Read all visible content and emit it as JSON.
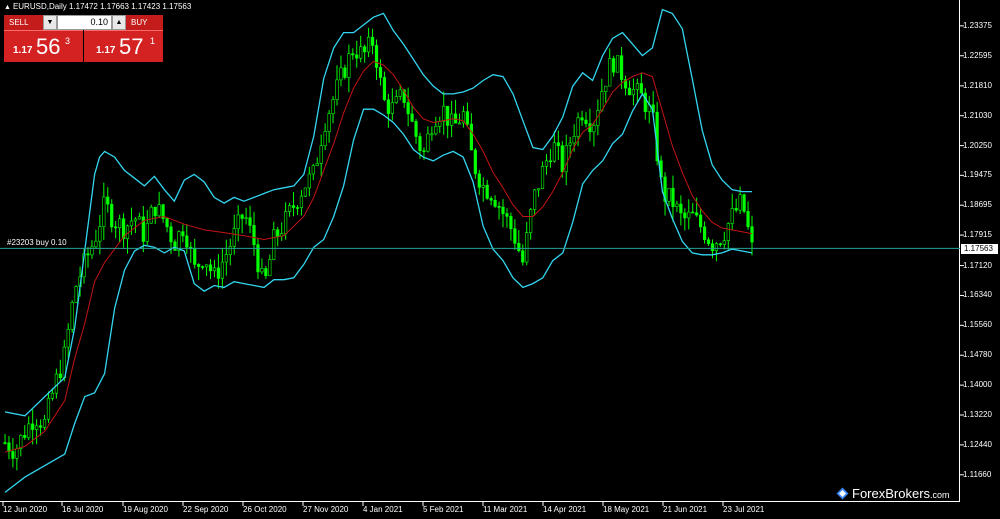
{
  "chart_title": "EURUSD,Daily  1.17472 1.17663 1.17423 1.17563",
  "trade_panel": {
    "sell_label": "SELL",
    "buy_label": "BUY",
    "volume": "0.10",
    "sell_price": {
      "prefix": "1.17",
      "big": "56",
      "sup": "3"
    },
    "buy_price": {
      "prefix": "1.17",
      "big": "57",
      "sup": "1"
    }
  },
  "order_line_label": "#23203 buy 0.10",
  "current_price_tag": "1.17563",
  "watermark": "ForexBrokers",
  "watermark_suffix": ".com",
  "colors": {
    "background": "#000000",
    "candle": "#00ff00",
    "bollinger": "#33d6f0",
    "middle_band": "#c41414",
    "order_line": "#2aa198",
    "sell_button": "#d42222"
  },
  "chart_data": {
    "type": "candlestick",
    "symbol": "EURUSD",
    "timeframe": "Daily",
    "ylim": [
      1.1095,
      1.2405
    ],
    "y_ticks": [
      "1.23375",
      "1.22595",
      "1.21810",
      "1.21030",
      "1.20250",
      "1.19475",
      "1.18695",
      "1.17915",
      "1.17120",
      "1.16340",
      "1.15560",
      "1.14780",
      "1.14000",
      "1.13220",
      "1.12440",
      "1.11660"
    ],
    "x_ticks": [
      "12 Jun 2020",
      "16 Jul 2020",
      "19 Aug 2020",
      "22 Sep 2020",
      "26 Oct 2020",
      "27 Nov 2020",
      "4 Jan 2021",
      "5 Feb 2021",
      "11 Mar 2021",
      "14 Apr 2021",
      "18 May 2021",
      "21 Jun 2021",
      "23 Jul 2021"
    ],
    "current_price": 1.17563,
    "order_price": 1.1758,
    "indicator": "Bollinger Bands",
    "close_path": [
      [
        0,
        1.125
      ],
      [
        10,
        1.123
      ],
      [
        20,
        1.128
      ],
      [
        30,
        1.132
      ],
      [
        40,
        1.13
      ],
      [
        50,
        1.14
      ],
      [
        60,
        1.148
      ],
      [
        70,
        1.165
      ],
      [
        80,
        1.172
      ],
      [
        90,
        1.178
      ],
      [
        100,
        1.187
      ],
      [
        110,
        1.183
      ],
      [
        120,
        1.181
      ],
      [
        130,
        1.184
      ],
      [
        140,
        1.179
      ],
      [
        150,
        1.187
      ],
      [
        160,
        1.183
      ],
      [
        170,
        1.177
      ],
      [
        180,
        1.182
      ],
      [
        190,
        1.17
      ],
      [
        200,
        1.174
      ],
      [
        210,
        1.168
      ],
      [
        220,
        1.173
      ],
      [
        230,
        1.179
      ],
      [
        240,
        1.185
      ],
      [
        250,
        1.177
      ],
      [
        260,
        1.165
      ],
      [
        270,
        1.178
      ],
      [
        280,
        1.182
      ],
      [
        290,
        1.187
      ],
      [
        300,
        1.192
      ],
      [
        310,
        1.195
      ],
      [
        320,
        1.208
      ],
      [
        330,
        1.215
      ],
      [
        340,
        1.222
      ],
      [
        350,
        1.228
      ],
      [
        360,
        1.226
      ],
      [
        370,
        1.23
      ],
      [
        380,
        1.214
      ],
      [
        390,
        1.212
      ],
      [
        400,
        1.216
      ],
      [
        410,
        1.207
      ],
      [
        420,
        1.2
      ],
      [
        430,
        1.21
      ],
      [
        440,
        1.212
      ],
      [
        450,
        1.207
      ],
      [
        460,
        1.211
      ],
      [
        470,
        1.198
      ],
      [
        480,
        1.192
      ],
      [
        490,
        1.19
      ],
      [
        500,
        1.185
      ],
      [
        510,
        1.18
      ],
      [
        520,
        1.172
      ],
      [
        530,
        1.188
      ],
      [
        540,
        1.196
      ],
      [
        550,
        1.203
      ],
      [
        560,
        1.197
      ],
      [
        570,
        1.206
      ],
      [
        580,
        1.212
      ],
      [
        590,
        1.208
      ],
      [
        600,
        1.218
      ],
      [
        610,
        1.225
      ],
      [
        620,
        1.221
      ],
      [
        630,
        1.217
      ],
      [
        640,
        1.215
      ],
      [
        650,
        1.21
      ],
      [
        660,
        1.19
      ],
      [
        670,
        1.188
      ],
      [
        680,
        1.183
      ],
      [
        690,
        1.184
      ],
      [
        700,
        1.181
      ],
      [
        710,
        1.177
      ],
      [
        720,
        1.179
      ],
      [
        730,
        1.184
      ],
      [
        740,
        1.188
      ],
      [
        750,
        1.1756
      ]
    ],
    "upper_band": [
      [
        0,
        1.133
      ],
      [
        20,
        1.132
      ],
      [
        40,
        1.137
      ],
      [
        60,
        1.142
      ],
      [
        70,
        1.155
      ],
      [
        80,
        1.175
      ],
      [
        90,
        1.195
      ],
      [
        95,
        1.1995
      ],
      [
        100,
        1.201
      ],
      [
        110,
        1.1995
      ],
      [
        120,
        1.196
      ],
      [
        130,
        1.194
      ],
      [
        140,
        1.192
      ],
      [
        150,
        1.1945
      ],
      [
        160,
        1.191
      ],
      [
        170,
        1.188
      ],
      [
        180,
        1.1935
      ],
      [
        190,
        1.195
      ],
      [
        200,
        1.193
      ],
      [
        210,
        1.189
      ],
      [
        220,
        1.1875
      ],
      [
        230,
        1.189
      ],
      [
        240,
        1.188
      ],
      [
        250,
        1.189
      ],
      [
        260,
        1.19
      ],
      [
        270,
        1.191
      ],
      [
        280,
        1.1915
      ],
      [
        290,
        1.192
      ],
      [
        300,
        1.195
      ],
      [
        310,
        1.205
      ],
      [
        320,
        1.22
      ],
      [
        330,
        1.228
      ],
      [
        340,
        1.232
      ],
      [
        350,
        1.232
      ],
      [
        360,
        1.234
      ],
      [
        370,
        1.236
      ],
      [
        380,
        1.237
      ],
      [
        390,
        1.2325
      ],
      [
        400,
        1.229
      ],
      [
        410,
        1.225
      ],
      [
        420,
        1.221
      ],
      [
        430,
        1.218
      ],
      [
        440,
        1.216
      ],
      [
        450,
        1.216
      ],
      [
        460,
        1.2165
      ],
      [
        470,
        1.2175
      ],
      [
        480,
        1.2195
      ],
      [
        490,
        1.221
      ],
      [
        500,
        1.2205
      ],
      [
        510,
        1.216
      ],
      [
        520,
        1.209
      ],
      [
        530,
        1.202
      ],
      [
        540,
        1.2015
      ],
      [
        550,
        1.205
      ],
      [
        560,
        1.21
      ],
      [
        570,
        1.218
      ],
      [
        580,
        1.2215
      ],
      [
        590,
        1.2195
      ],
      [
        600,
        1.226
      ],
      [
        610,
        1.2305
      ],
      [
        620,
        1.232
      ],
      [
        630,
        1.229
      ],
      [
        640,
        1.226
      ],
      [
        650,
        1.228
      ],
      [
        660,
        1.238
      ],
      [
        670,
        1.237
      ],
      [
        680,
        1.233
      ],
      [
        690,
        1.22
      ],
      [
        700,
        1.2065
      ],
      [
        710,
        1.1975
      ],
      [
        720,
        1.1935
      ],
      [
        730,
        1.191
      ],
      [
        740,
        1.1905
      ],
      [
        750,
        1.1905
      ]
    ],
    "middle_band": [
      [
        0,
        1.1225
      ],
      [
        20,
        1.124
      ],
      [
        40,
        1.128
      ],
      [
        60,
        1.136
      ],
      [
        70,
        1.147
      ],
      [
        80,
        1.156
      ],
      [
        90,
        1.167
      ],
      [
        100,
        1.172
      ],
      [
        120,
        1.179
      ],
      [
        140,
        1.183
      ],
      [
        160,
        1.184
      ],
      [
        180,
        1.182
      ],
      [
        200,
        1.1805
      ],
      [
        220,
        1.1798
      ],
      [
        240,
        1.179
      ],
      [
        260,
        1.178
      ],
      [
        280,
        1.179
      ],
      [
        300,
        1.184
      ],
      [
        310,
        1.189
      ],
      [
        320,
        1.196
      ],
      [
        330,
        1.203
      ],
      [
        340,
        1.211
      ],
      [
        350,
        1.2175
      ],
      [
        360,
        1.222
      ],
      [
        370,
        1.2245
      ],
      [
        380,
        1.2235
      ],
      [
        390,
        1.221
      ],
      [
        400,
        1.217
      ],
      [
        410,
        1.2125
      ],
      [
        420,
        1.2095
      ],
      [
        430,
        1.2085
      ],
      [
        440,
        1.209
      ],
      [
        450,
        1.2095
      ],
      [
        460,
        1.209
      ],
      [
        470,
        1.2055
      ],
      [
        480,
        1.201
      ],
      [
        490,
        1.1955
      ],
      [
        500,
        1.1915
      ],
      [
        510,
        1.187
      ],
      [
        520,
        1.184
      ],
      [
        530,
        1.184
      ],
      [
        540,
        1.1865
      ],
      [
        550,
        1.1905
      ],
      [
        560,
        1.1955
      ],
      [
        570,
        1.2015
      ],
      [
        580,
        1.206
      ],
      [
        590,
        1.208
      ],
      [
        600,
        1.212
      ],
      [
        610,
        1.2165
      ],
      [
        620,
        1.219
      ],
      [
        630,
        1.2205
      ],
      [
        640,
        1.2215
      ],
      [
        650,
        1.2205
      ],
      [
        660,
        1.2115
      ],
      [
        670,
        1.2025
      ],
      [
        680,
        1.1955
      ],
      [
        690,
        1.1895
      ],
      [
        700,
        1.1855
      ],
      [
        710,
        1.1825
      ],
      [
        720,
        1.181
      ],
      [
        730,
        1.1805
      ],
      [
        740,
        1.18
      ],
      [
        750,
        1.1795
      ]
    ],
    "lower_band": [
      [
        0,
        1.112
      ],
      [
        20,
        1.116
      ],
      [
        40,
        1.119
      ],
      [
        60,
        1.122
      ],
      [
        70,
        1.13
      ],
      [
        80,
        1.137
      ],
      [
        90,
        1.138
      ],
      [
        100,
        1.143
      ],
      [
        110,
        1.16
      ],
      [
        120,
        1.17
      ],
      [
        130,
        1.175
      ],
      [
        140,
        1.1765
      ],
      [
        150,
        1.176
      ],
      [
        160,
        1.1745
      ],
      [
        170,
        1.176
      ],
      [
        180,
        1.175
      ],
      [
        190,
        1.1665
      ],
      [
        200,
        1.1645
      ],
      [
        210,
        1.166
      ],
      [
        220,
        1.1655
      ],
      [
        230,
        1.167
      ],
      [
        240,
        1.1665
      ],
      [
        250,
        1.166
      ],
      [
        260,
        1.1655
      ],
      [
        270,
        1.1675
      ],
      [
        280,
        1.1675
      ],
      [
        290,
        1.168
      ],
      [
        300,
        1.1715
      ],
      [
        310,
        1.176
      ],
      [
        320,
        1.178
      ],
      [
        330,
        1.184
      ],
      [
        340,
        1.192
      ],
      [
        350,
        1.204
      ],
      [
        360,
        1.212
      ],
      [
        370,
        1.212
      ],
      [
        380,
        1.2105
      ],
      [
        390,
        1.2085
      ],
      [
        400,
        1.2055
      ],
      [
        410,
        1.2015
      ],
      [
        420,
        1.1995
      ],
      [
        430,
        1.1985
      ],
      [
        440,
        1.2
      ],
      [
        450,
        1.201
      ],
      [
        460,
        1.1995
      ],
      [
        470,
        1.193
      ],
      [
        480,
        1.1815
      ],
      [
        490,
        1.1755
      ],
      [
        500,
        1.1725
      ],
      [
        510,
        1.168
      ],
      [
        520,
        1.1655
      ],
      [
        530,
        1.1665
      ],
      [
        540,
        1.168
      ],
      [
        550,
        1.1725
      ],
      [
        560,
        1.1745
      ],
      [
        570,
        1.1825
      ],
      [
        580,
        1.1925
      ],
      [
        590,
        1.196
      ],
      [
        600,
        1.1985
      ],
      [
        610,
        1.203
      ],
      [
        620,
        1.2055
      ],
      [
        630,
        1.2115
      ],
      [
        640,
        1.216
      ],
      [
        650,
        1.212
      ],
      [
        660,
        1.1905
      ],
      [
        670,
        1.1835
      ],
      [
        680,
        1.1775
      ],
      [
        690,
        1.1745
      ],
      [
        700,
        1.174
      ],
      [
        710,
        1.174
      ],
      [
        720,
        1.1745
      ],
      [
        730,
        1.1755
      ],
      [
        740,
        1.175
      ],
      [
        750,
        1.1745
      ]
    ]
  }
}
